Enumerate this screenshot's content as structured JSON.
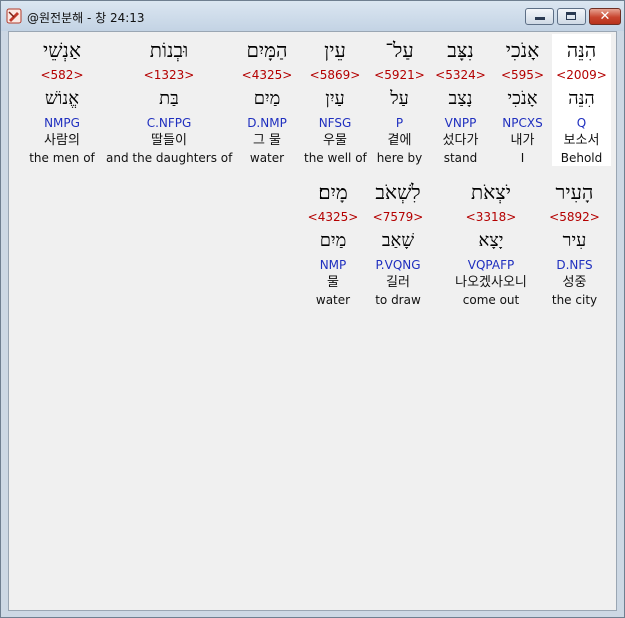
{
  "window": {
    "title": "@원전분해 - 창 24:13",
    "close_glyph": "✕",
    "app_icon": "bible-icon"
  },
  "rows": [
    [
      {
        "hebrew": "הִנֵּה",
        "strong": "<2009>",
        "lemma": "הִנֵּה",
        "parse": "Q",
        "korean": "보소서",
        "english": "Behold",
        "selected": true
      },
      {
        "hebrew": "אָנֹכִי",
        "strong": "<595>",
        "lemma": "אָנֹכִי",
        "parse": "NPCXS",
        "korean": "내가",
        "english": "I"
      },
      {
        "hebrew": "נִצָּב",
        "strong": "<5324>",
        "lemma": "נָצַב",
        "parse": "VNPP",
        "korean": "섰다가",
        "english": "stand"
      },
      {
        "hebrew": "עַל־",
        "strong": "<5921>",
        "lemma": "עַל",
        "parse": "P",
        "korean": "곁에",
        "english": "here by"
      },
      {
        "hebrew": "עֵין",
        "strong": "<5869>",
        "lemma": "עַיִן",
        "parse": "NFSG",
        "korean": "우물",
        "english": "the well of"
      },
      {
        "hebrew": "הַמָּיִם",
        "strong": "<4325>",
        "lemma": "מַיִם",
        "parse": "D.NMP",
        "korean": "그 물",
        "english": "water"
      },
      {
        "hebrew": "וּבְנוֹת",
        "strong": "<1323>",
        "lemma": "בַּת",
        "parse": "C.NFPG",
        "korean": "딸들이",
        "english": "and the daughters of"
      },
      {
        "hebrew": "אַנְשֵׁי",
        "strong": "<582>",
        "lemma": "אֱנוֹשׁ",
        "parse": "NMPG",
        "korean": "사람의",
        "english": "the men of"
      }
    ],
    [
      {
        "hebrew": "הָעִיר",
        "strong": "<5892>",
        "lemma": "עִיר",
        "parse": "D.NFS",
        "korean": "성중",
        "english": "the city"
      },
      {
        "hebrew": "יֹצְאֹת",
        "strong": "<3318>",
        "lemma": "יָצָא",
        "parse": "VQPAFP",
        "korean": "나오겠사오니",
        "english": "come out"
      },
      {
        "hebrew": "לִשְׁאֹב",
        "strong": "<7579>",
        "lemma": "שָׁאַב",
        "parse": "P.VQNG",
        "korean": "길러",
        "english": "to draw"
      },
      {
        "hebrew": "מָיִם׃",
        "strong": "<4325>",
        "lemma": "מַיִם",
        "parse": "NMP",
        "korean": "물",
        "english": "water"
      }
    ]
  ]
}
